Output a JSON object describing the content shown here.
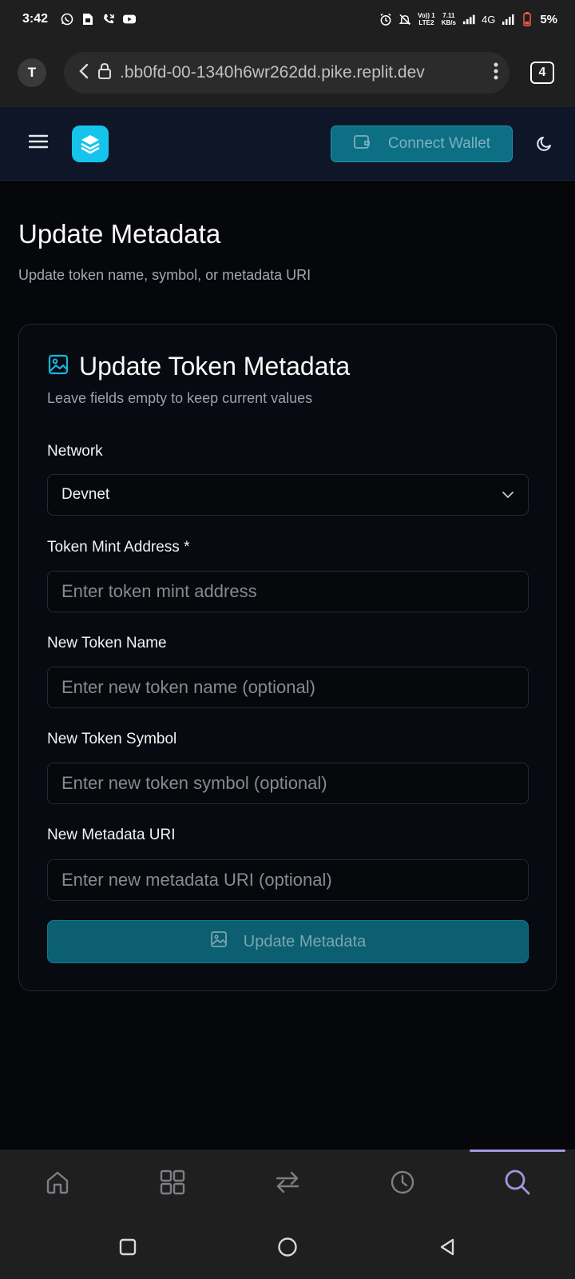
{
  "status_bar": {
    "time": "3:42",
    "lte_top": "Vo)) 1",
    "lte_bottom": "LTE2",
    "speed_top": "7.11",
    "speed_bottom": "KB/s",
    "network": "4G",
    "battery": "5%"
  },
  "browser": {
    "profile_initial": "T",
    "url": ".bb0fd-00-1340h6wr262dd.pike.replit.dev",
    "tab_count": "4"
  },
  "header": {
    "connect_wallet_label": "Connect Wallet"
  },
  "page": {
    "title": "Update Metadata",
    "subtitle": "Update token name, symbol, or metadata URI"
  },
  "card": {
    "title": "Update Token Metadata",
    "description": "Leave fields empty to keep current values",
    "network_label": "Network",
    "network_value": "Devnet",
    "mint_label": "Token Mint Address *",
    "mint_placeholder": "Enter token mint address",
    "name_label": "New Token Name",
    "name_placeholder": "Enter new token name (optional)",
    "symbol_label": "New Token Symbol",
    "symbol_placeholder": "Enter new token symbol (optional)",
    "uri_label": "New Metadata URI",
    "uri_placeholder": "Enter new metadata URI (optional)",
    "submit_label": "Update Metadata"
  },
  "bottom_nav": {
    "items": [
      "home-icon",
      "grid-icon",
      "swap-icon",
      "history-icon",
      "search-icon"
    ],
    "active": "search-icon"
  },
  "colors": {
    "accent": "#14c4ec",
    "button_bg": "#0d6f84",
    "active_nav": "#a794e0"
  }
}
